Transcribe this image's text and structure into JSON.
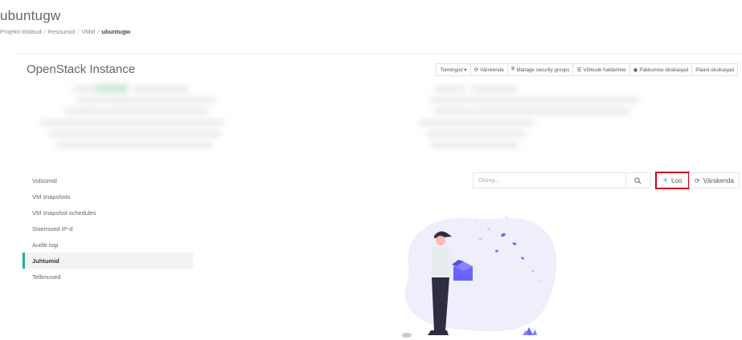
{
  "header": {
    "title": "ubuntugw",
    "breadcrumb": [
      "Projekti töölaud",
      "Ressursid",
      "VMid",
      "ubuntugw"
    ]
  },
  "panel": {
    "title": "OpenStack Instance"
  },
  "toolbar": {
    "actions_label": "Toimingud ▾",
    "refresh_label": "Värskenda",
    "security_groups_label": "Manage security groups",
    "network_label": "Võrkude haldamine",
    "offerings_label": "Pakkumise üksikasjad",
    "plan_label": "Plaani üksikasjad"
  },
  "subnav": {
    "items": [
      {
        "label": "Volüümid"
      },
      {
        "label": "VM snapshots"
      },
      {
        "label": "VM snapshot schedules"
      },
      {
        "label": "Sisemised IP-d"
      },
      {
        "label": "Auditi logi"
      },
      {
        "label": "Juhtumid",
        "active": true
      },
      {
        "label": "Tellimused"
      }
    ]
  },
  "tab_content": {
    "search_placeholder": "Otsing...",
    "create_label": "Loo",
    "refresh_label": "Värskenda"
  },
  "colors": {
    "accent": "#1ab394",
    "highlight": "#d0021b",
    "illustration": "#6c63ff"
  }
}
